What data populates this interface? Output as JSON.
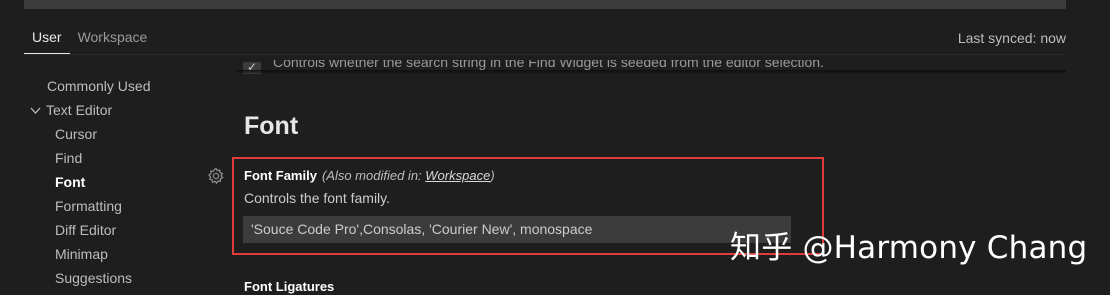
{
  "tabs": [
    "User",
    "Workspace"
  ],
  "last_synced": "Last synced: now",
  "toc": {
    "commonly_used": "Commonly Used",
    "text_editor": "Text Editor",
    "children": [
      "Cursor",
      "Find",
      "Font",
      "Formatting",
      "Diff Editor",
      "Minimap",
      "Suggestions"
    ],
    "selected": "Font"
  },
  "prev_setting_text": "Controls whether the search string in the Find Widget is seeded from the editor selection.",
  "section_title": "Font",
  "setting": {
    "name": "Font Family",
    "modified_prefix": "(Also modified in: ",
    "modified_link": "Workspace",
    "modified_suffix": ")",
    "description": "Controls the font family.",
    "value": "'Souce Code Pro',Consolas, 'Courier New', monospace"
  },
  "next_setting_name": "Font Ligatures",
  "watermark": "知乎 @Harmony Chang",
  "colors": {
    "highlight_border": "#e03c3c",
    "background": "#1e1e1e",
    "input_background": "#3c3c3c"
  },
  "icons": {
    "gear": "gear-icon",
    "chevron": "chevron-down-icon",
    "checkbox": "checkbox-checked-icon"
  }
}
